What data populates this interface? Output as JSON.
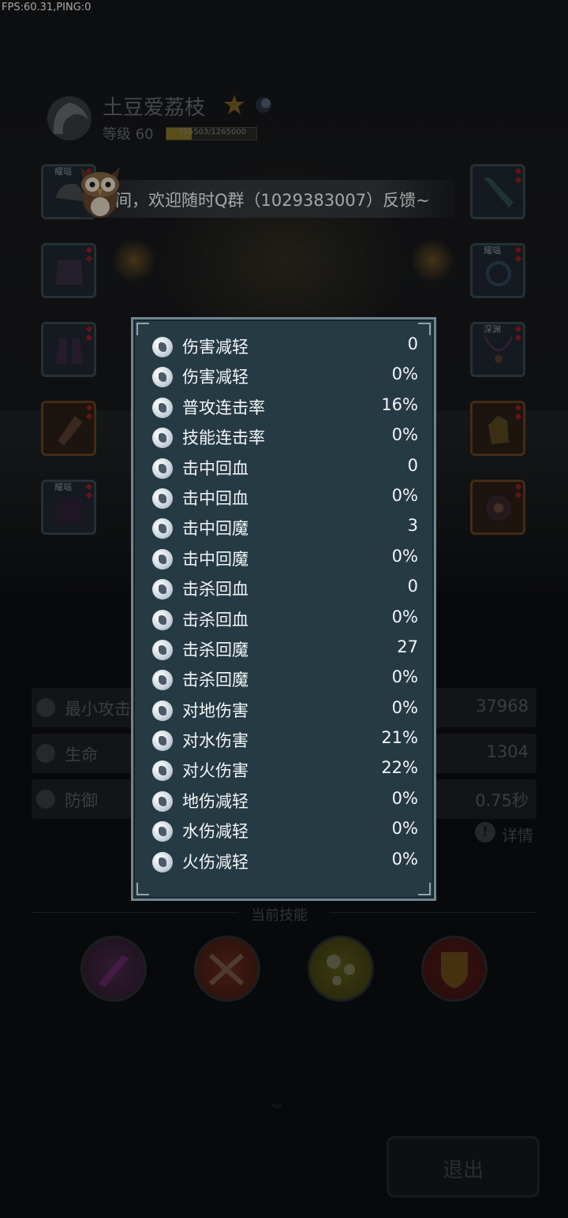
{
  "hud": {
    "fps": "FPS:60.31,PING:0"
  },
  "player": {
    "name": "土豆爱荔枝",
    "level_label": "等级 60",
    "exp_text": "355503/1265000",
    "exp_progress": 0.28
  },
  "notice": {
    "text": "间，欢迎随时Q群（1029383007）反馈~"
  },
  "equipment": {
    "left_tags": [
      "耀瑙",
      "",
      "",
      "",
      "耀瑙"
    ],
    "right_tags": [
      "",
      "耀瑙",
      "深渊",
      "",
      ""
    ]
  },
  "background_stats": [
    {
      "label": "最小攻击",
      "value": "37968"
    },
    {
      "label": "生命",
      "value": "1304"
    },
    {
      "label": "防御",
      "value": "0.75秒"
    }
  ],
  "details_label": "详情",
  "skills_title": "当前技能",
  "exit_label": "退出",
  "attributes": [
    {
      "label": "伤害减轻",
      "value": "0"
    },
    {
      "label": "伤害减轻",
      "value": "0%"
    },
    {
      "label": "普攻连击率",
      "value": "16%"
    },
    {
      "label": "技能连击率",
      "value": "0%"
    },
    {
      "label": "击中回血",
      "value": "0"
    },
    {
      "label": "击中回血",
      "value": "0%"
    },
    {
      "label": "击中回魔",
      "value": "3"
    },
    {
      "label": "击中回魔",
      "value": "0%"
    },
    {
      "label": "击杀回血",
      "value": "0"
    },
    {
      "label": "击杀回血",
      "value": "0%"
    },
    {
      "label": "击杀回魔",
      "value": "27"
    },
    {
      "label": "击杀回魔",
      "value": "0%"
    },
    {
      "label": "对地伤害",
      "value": "0%"
    },
    {
      "label": "对水伤害",
      "value": "21%"
    },
    {
      "label": "对火伤害",
      "value": "22%"
    },
    {
      "label": "地伤减轻",
      "value": "0%"
    },
    {
      "label": "水伤减轻",
      "value": "0%"
    },
    {
      "label": "火伤减轻",
      "value": "0%"
    }
  ],
  "colors": {
    "panel_bg": "#263a44",
    "panel_border": "#6f8792",
    "skill_purple": "#5a2a5a",
    "skill_red": "#7a2a1a",
    "skill_yellow": "#6a6a1a",
    "skill_shield": "#6a1a1a"
  }
}
